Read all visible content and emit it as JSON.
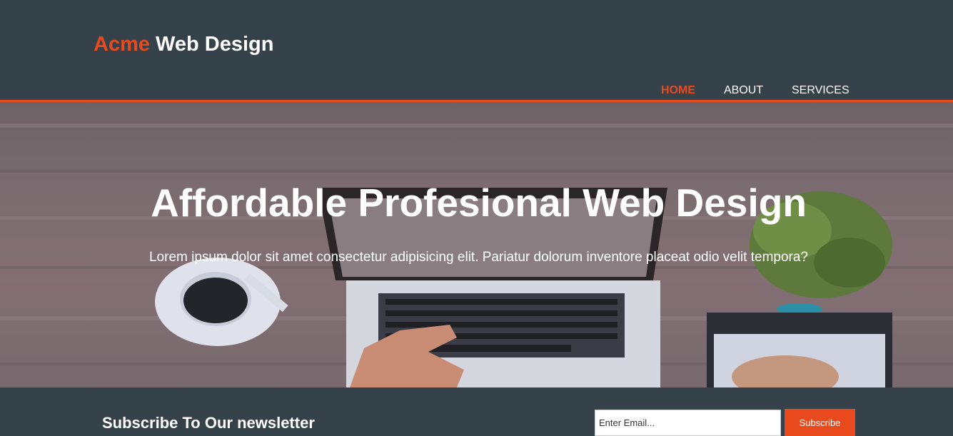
{
  "header": {
    "brand_highlight": "Acme",
    "brand_rest": " Web Design",
    "nav": [
      {
        "label": "HOME",
        "active": true
      },
      {
        "label": "ABOUT",
        "active": false
      },
      {
        "label": "SERVICES",
        "active": false
      }
    ]
  },
  "showcase": {
    "title": "Affordable Profesional Web Design",
    "text": "Lorem ipsum dolor sit amet consectetur adipisicing elit. Pariatur dolorum inventore placeat odio velit tempora?"
  },
  "newsletter": {
    "title": "Subscribe To Our newsletter",
    "email_placeholder": "Enter Email...",
    "button_label": "Subscribe"
  },
  "colors": {
    "header_bg": "#35424a",
    "accent": "#e8491d",
    "text": "#ffffff"
  }
}
